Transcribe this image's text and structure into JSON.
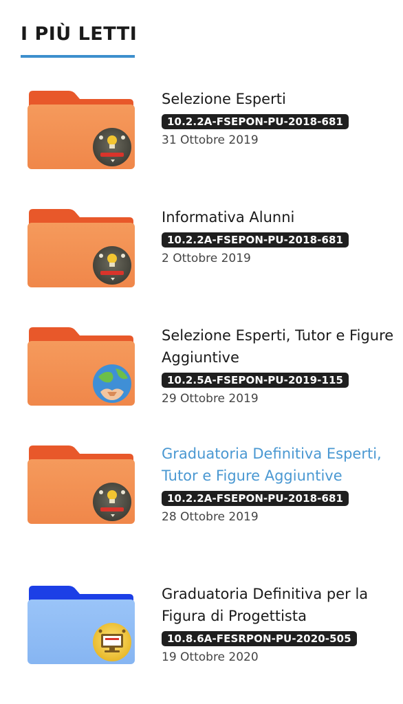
{
  "section": {
    "title": "I PIÙ LETTI"
  },
  "colors": {
    "accent": "#3d8fcd",
    "link": "#4a98d2",
    "tag_bg": "#1f1f1f",
    "folder_orange": "#f0884a",
    "folder_blue": "#8ab8f5"
  },
  "items": [
    {
      "title": "Selezione Esperti",
      "tag": "10.2.2A-FSEPON-PU-2018-681",
      "date": "31 Ottobre 2019",
      "folder": "orange-folder-icon",
      "badge": "lightbulb-badge-icon"
    },
    {
      "title": "Informativa Alunni",
      "tag": "10.2.2A-FSEPON-PU-2018-681",
      "date": "2 Ottobre 2019",
      "folder": "orange-folder-icon",
      "badge": "lightbulb-badge-icon"
    },
    {
      "title": "Selezione Esperti, Tutor e Figure Aggiuntive",
      "tag": "10.2.5A-FSEPON-PU-2019-115",
      "date": "29 Ottobre 2019",
      "folder": "orange-folder-icon",
      "badge": "globe-hands-badge-icon"
    },
    {
      "title": "Graduatoria Definitiva Esperti, Tutor e Figure Aggiuntive",
      "tag": "10.2.2A-FSEPON-PU-2018-681",
      "date": "28 Ottobre 2019",
      "folder": "orange-folder-icon",
      "badge": "lightbulb-badge-icon"
    },
    {
      "title": "Graduatoria Definitiva per la Figura di Progettista",
      "tag": "10.8.6A-FESRPON-PU-2020-505",
      "date": "19 Ottobre 2020",
      "folder": "blue-folder-icon",
      "badge": "computer-badge-icon"
    }
  ]
}
